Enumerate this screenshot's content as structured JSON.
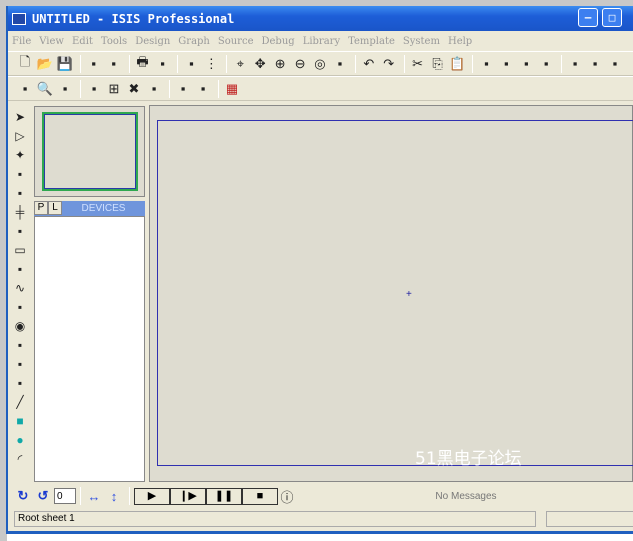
{
  "window": {
    "title": "UNTITLED - ISIS Professional",
    "logo": "ISIS",
    "minimize": "minimize-icon",
    "maximize": "maximize-icon"
  },
  "menu": [
    "File",
    "View",
    "Edit",
    "Tools",
    "Design",
    "Graph",
    "Source",
    "Debug",
    "Library",
    "Template",
    "System",
    "Help"
  ],
  "toolbar1": [
    "new-icon",
    "open-icon",
    "save-icon",
    "|",
    "import-icon",
    "export-icon",
    "|",
    "print-icon",
    "page-icon",
    "|",
    "redraw-icon",
    "grid-icon",
    "|",
    "origin-icon",
    "pan-icon",
    "zoom-in-icon",
    "zoom-out-icon",
    "zoom-all-icon",
    "zoom-area-icon",
    "|",
    "undo-icon",
    "redo-icon",
    "|",
    "cut-icon",
    "copy-icon",
    "paste-icon",
    "|",
    "block-copy-icon",
    "block-move-icon",
    "block-rotate-icon",
    "block-delete-icon",
    "|",
    "pick-device-icon",
    "make-device-icon",
    "package-icon",
    "autoroute-icon"
  ],
  "toolbar2": [
    "design-explorer-icon",
    "search-icon",
    "property-tool-icon",
    "|",
    "new-sheet-icon",
    "add-sheet-icon",
    "remove-sheet-icon",
    "goto-sheet-icon",
    "|",
    "bill-of-materials-icon",
    "electrical-check-icon",
    "|",
    "ares-icon"
  ],
  "left_tools": [
    "select-icon",
    "component-icon",
    "junction-icon",
    "wire-label-icon",
    "text-script-icon",
    "bus-icon",
    "subcircuit-icon",
    "terminal-icon",
    "device-pin-icon",
    "graph-icon",
    "tape-recorder-icon",
    "generator-icon",
    "voltage-probe-icon",
    "current-probe-icon",
    "virtual-instrument-icon",
    "line-icon",
    "box-icon",
    "circle-icon",
    "arc-icon"
  ],
  "devices": {
    "p_button": "P",
    "l_button": "L",
    "header": "DEVICES"
  },
  "watermark": "51黑电子论坛",
  "bottom": {
    "rotation_value": "0",
    "messages": "No Messages"
  },
  "status": {
    "sheet": "Root sheet 1"
  }
}
